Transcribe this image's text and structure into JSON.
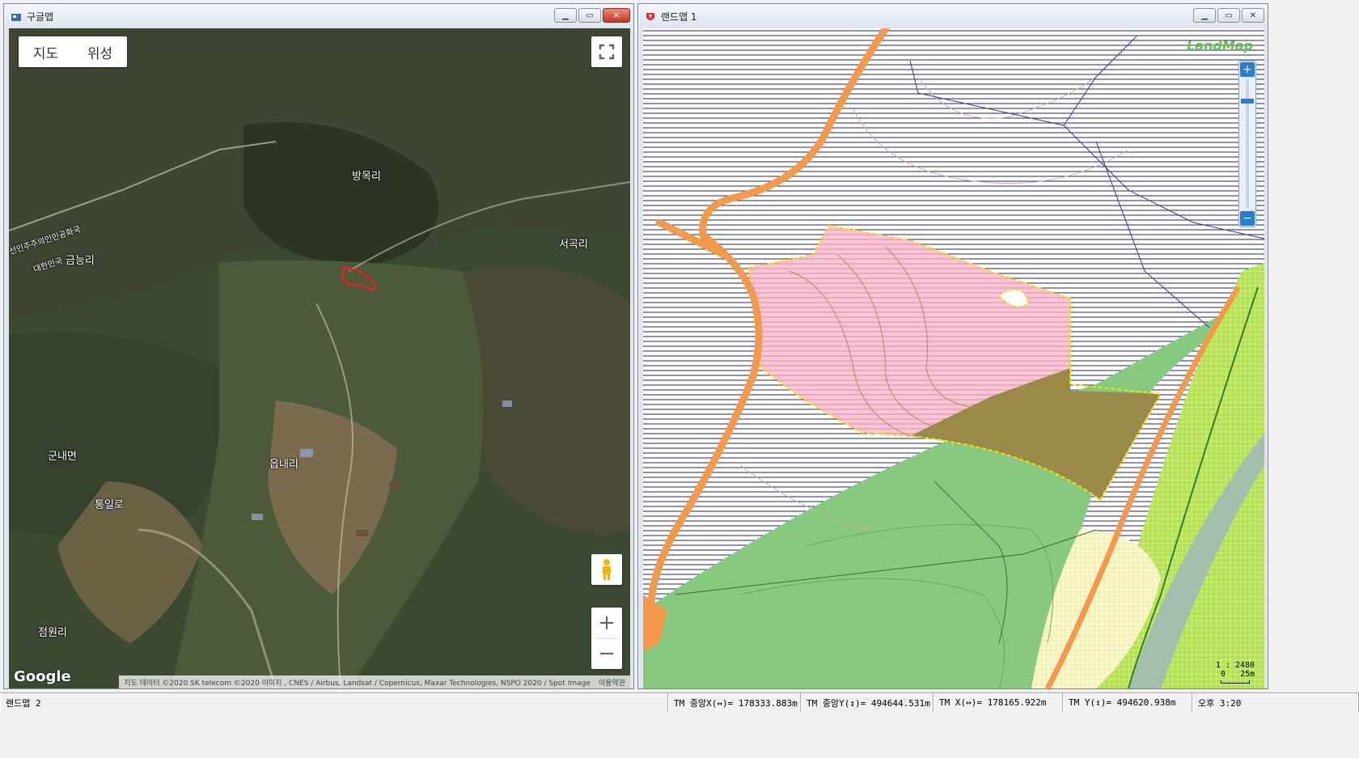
{
  "google_window": {
    "title": "구글맵",
    "map_type_buttons": [
      "지도",
      "위성"
    ],
    "place_labels": [
      {
        "id": "bangmokri",
        "text": "방목리"
      },
      {
        "id": "seogokri",
        "text": "서곡리"
      },
      {
        "id": "geumneungri",
        "text": "금능리"
      },
      {
        "id": "dprk",
        "text": "선인주주의인민공화국"
      },
      {
        "id": "rok",
        "text": "대한민국"
      },
      {
        "id": "gunnaemyeon",
        "text": "군내면"
      },
      {
        "id": "eupnaeri",
        "text": "읍내리"
      },
      {
        "id": "tongilro",
        "text": "통일로"
      },
      {
        "id": "jeomwonri",
        "text": "점원리"
      }
    ],
    "logo": "Google",
    "attribution": "지도 데이터 ©2020 SK telecom ©2020 이미지 , CNES / Airbus, Landsat / Copernicus, Maxar Technologies, NSPO 2020 / Spot Image",
    "terms": "이용약관",
    "highlight_color": "#e8202a"
  },
  "landmap_window": {
    "title": "랜드맵 1",
    "logo": "LandMap",
    "zoom_plus": "+",
    "zoom_minus": "−",
    "scale_text": "1 : 2480",
    "scale_bar_labels": [
      "0",
      "25m"
    ],
    "colors": {
      "parcel_pink": "#f7c6d6",
      "forest_green": "#86c97f",
      "olive": "#9a8a4a",
      "road_orange": "#f2a25a",
      "hatch_blue": "#1a237e",
      "boundary_yellow": "#f5e000",
      "light_yellow": "#f6f3b8",
      "lime_grid": "#b6e05a",
      "river": "#9fb6b8"
    }
  },
  "status_bar": {
    "app": "랜드맵 2",
    "tm_center_x": "TM 중앙X(↔)= 178333.883m",
    "tm_center_y": "TM 중앙Y(↕)= 494644.531m",
    "tm_x": "TM X(↔)= 178165.922m",
    "tm_y": "TM Y(↕)= 494620.938m",
    "clock": "오후 3:20"
  }
}
